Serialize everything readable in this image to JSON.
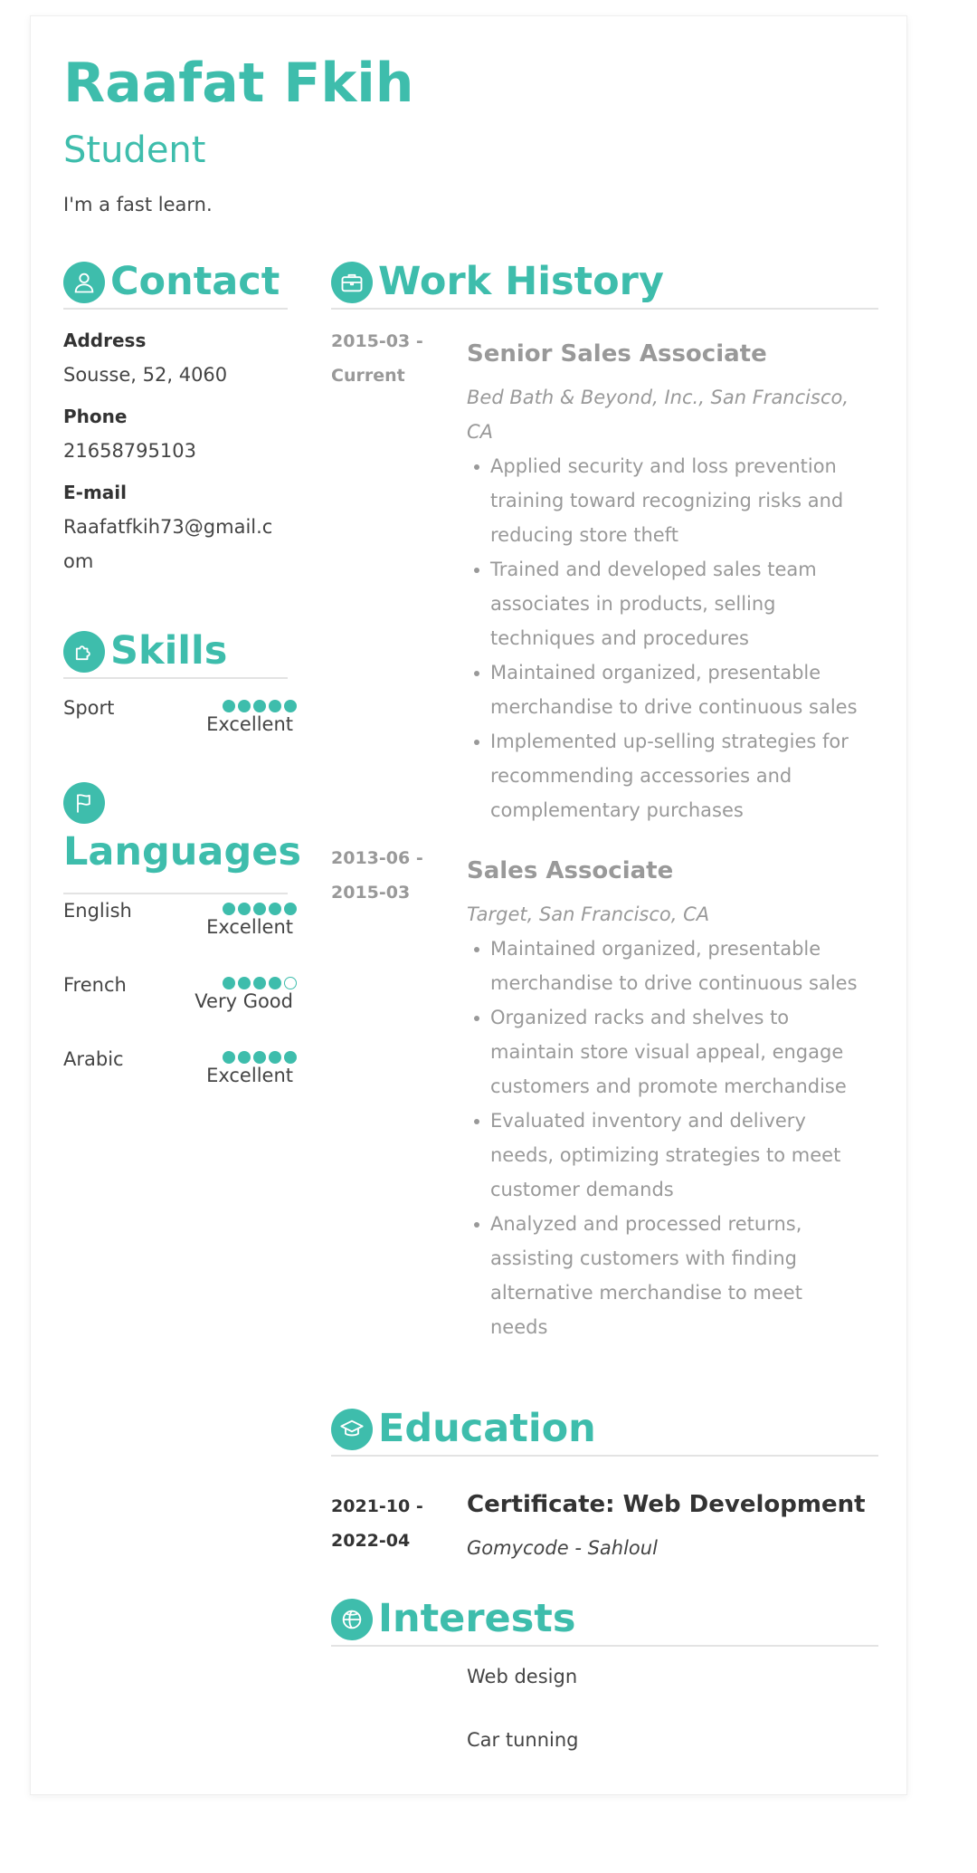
{
  "header": {
    "name": "Raafat Fkih",
    "role": "Student",
    "summary": "I'm a fast learn."
  },
  "colors": {
    "accent": "#3ebdac",
    "muted": "#999999",
    "text": "#333333"
  },
  "contact": {
    "title": "Contact",
    "icon": "user-icon",
    "address_label": "Address",
    "address": "Sousse, 52, 4060",
    "phone_label": "Phone",
    "phone": "21658795103",
    "email_label": "E-mail",
    "email_line1": "Raafatfkih73@gmail.c",
    "email_line2": "om"
  },
  "skills": {
    "title": "Skills",
    "icon": "puzzle-icon",
    "items": [
      {
        "name": "Sport",
        "level": "Excellent",
        "rating": 5,
        "max": 5
      }
    ]
  },
  "languages": {
    "title": "Languages",
    "icon": "flag-icon",
    "items": [
      {
        "name": "English",
        "level": "Excellent",
        "rating": 5,
        "max": 5
      },
      {
        "name": "French",
        "level": "Very Good",
        "rating": 4,
        "max": 5
      },
      {
        "name": "Arabic",
        "level": "Excellent",
        "rating": 5,
        "max": 5
      }
    ]
  },
  "work": {
    "title": "Work History",
    "icon": "briefcase-icon",
    "jobs": [
      {
        "date_start": "2015-03 -",
        "date_end": "Current",
        "title": "Senior Sales Associate",
        "company_line1": "Bed Bath & Beyond, Inc., San Francisco,",
        "company_line2": "CA",
        "bullets": [
          [
            "Applied security and loss prevention",
            "training toward recognizing risks and",
            "reducing store theft"
          ],
          [
            "Trained and developed sales team",
            "associates in products, selling",
            "techniques and procedures"
          ],
          [
            "Maintained organized, presentable",
            "merchandise to drive continuous sales"
          ],
          [
            "Implemented up-selling strategies for",
            "recommending accessories and",
            "complementary purchases"
          ]
        ]
      },
      {
        "date_start": "2013-06 -",
        "date_end": "2015-03",
        "title": "Sales Associate",
        "company_line1": "Target, San Francisco, CA",
        "bullets": [
          [
            "Maintained organized, presentable",
            "merchandise to drive continuous sales"
          ],
          [
            "Organized racks and shelves to",
            "maintain store visual appeal, engage",
            "customers and promote merchandise"
          ],
          [
            "Evaluated inventory and delivery",
            "needs, optimizing strategies to meet",
            "customer demands"
          ],
          [
            "Analyzed and processed returns,",
            "assisting customers with finding",
            "alternative merchandise to meet",
            "needs"
          ]
        ]
      }
    ]
  },
  "education": {
    "title": "Education",
    "icon": "graduation-cap-icon",
    "entries": [
      {
        "date_start": "2021-10 -",
        "date_end": "2022-04",
        "degree": "Certificate: Web Development",
        "school": "Gomycode - Sahloul"
      }
    ]
  },
  "interests": {
    "title": "Interests",
    "icon": "basketball-icon",
    "items": [
      "Web design",
      "Car tunning"
    ]
  }
}
